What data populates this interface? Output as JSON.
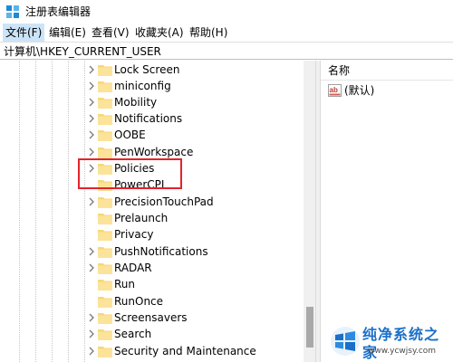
{
  "window": {
    "title": "注册表编辑器",
    "app_icon": "regedit-icon"
  },
  "menu": [
    {
      "label": "文件(F)"
    },
    {
      "label": "编辑(E)"
    },
    {
      "label": "查看(V)"
    },
    {
      "label": "收藏夹(A)"
    },
    {
      "label": "帮助(H)"
    }
  ],
  "address": {
    "path": "计算机\\HKEY_CURRENT_USER"
  },
  "tree": {
    "items": [
      {
        "label": "Lock Screen"
      },
      {
        "label": "miniconfig"
      },
      {
        "label": "Mobility"
      },
      {
        "label": "Notifications"
      },
      {
        "label": "OOBE"
      },
      {
        "label": "PenWorkspace"
      },
      {
        "label": "Policies",
        "highlighted": true
      },
      {
        "label": "PowerCPL"
      },
      {
        "label": "PrecisionTouchPad"
      },
      {
        "label": "Prelaunch"
      },
      {
        "label": "Privacy"
      },
      {
        "label": "PushNotifications"
      },
      {
        "label": "RADAR"
      },
      {
        "label": "Run"
      },
      {
        "label": "RunOnce"
      },
      {
        "label": "Screensavers"
      },
      {
        "label": "Search"
      },
      {
        "label": "Security and Maintenance"
      }
    ]
  },
  "values_pane": {
    "column_name": "名称",
    "rows": [
      {
        "name": "(默认)",
        "icon": "string-value-icon"
      }
    ]
  },
  "watermark": {
    "title": "纯净系统之家",
    "subtitle": "www.ycwjsy.com"
  },
  "colors": {
    "highlight_border": "#e4232b",
    "folder": "#f8d775",
    "menu_active": "#cce4f7"
  }
}
